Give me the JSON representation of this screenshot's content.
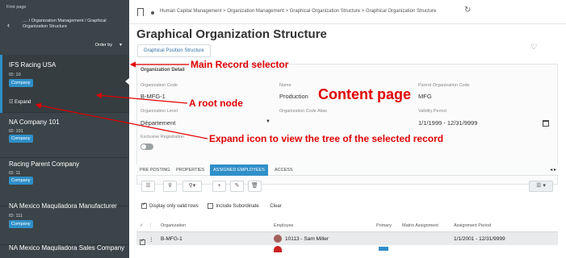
{
  "sidebar": {
    "first_page": "First page",
    "breadcrumb": ".... / Organization Management / Graphical Organization Structure",
    "order_by": "Order by",
    "expand_label": "Expand",
    "records": [
      {
        "name": "IFS Racing USA",
        "id": "ID:  10",
        "badge": "Company"
      },
      {
        "name": "NA Company 101",
        "id": "ID:  101",
        "badge": "Company"
      },
      {
        "name": "Racing Parent Company",
        "id": "ID:  11",
        "badge": "Company"
      },
      {
        "name": "NA Mexico Maquiladora Manufacturer",
        "id": "ID:  111",
        "badge": "Company"
      },
      {
        "name": "NA Mexico Maquiladora Sales Company"
      }
    ]
  },
  "breadcrumb": {
    "path": "Human Capital Management > Organization Management > Graphical Organization Structure > Graphical Organization Structure"
  },
  "page": {
    "title": "Graphical Organization Structure",
    "position_button": "Graphical Position Structure"
  },
  "detail": {
    "section_title": "Organization Detail",
    "org_code_label": "Organization Code",
    "org_code": "B-MFG-1",
    "name_label": "Name",
    "name": "Production",
    "parent_label": "Parent Organization Code",
    "parent": "MFG",
    "level_label": "Organization Level",
    "level": "Département",
    "alias_label": "Organization Code Alias",
    "validity_label": "Validity Period",
    "validity": "1/1/1999 - 12/31/9999",
    "exclusive_label": "Exclusive Registration"
  },
  "tabs": [
    "PRE POSTING",
    "PROPERTIES",
    "ASSIGNED EMPLOYEES",
    "ACCESS"
  ],
  "filters": {
    "valid_rows": "Display only valid rows",
    "include_sub": "Include Subordinate",
    "clear": "Clear"
  },
  "grid": {
    "headers": {
      "organization": "Organization",
      "employee": "Employee",
      "primary": "Primary",
      "matrix": "Matrix Assignment",
      "period": "Assignment Period"
    },
    "rows": [
      {
        "organization": "B-MFG-1",
        "employee": "10113 - Sam Miller",
        "period": "1/1/2001 - 12/31/9999"
      }
    ]
  },
  "annotations": {
    "main_record": "Main Record selector",
    "root_node": "A root node",
    "content_page": "Content page",
    "expand_icon": "Expand icon to view the tree of the selected record"
  },
  "colors": {
    "sidebar_bg": "#3b4448",
    "accent": "#2f8fc8",
    "annotation": "#e00000"
  }
}
